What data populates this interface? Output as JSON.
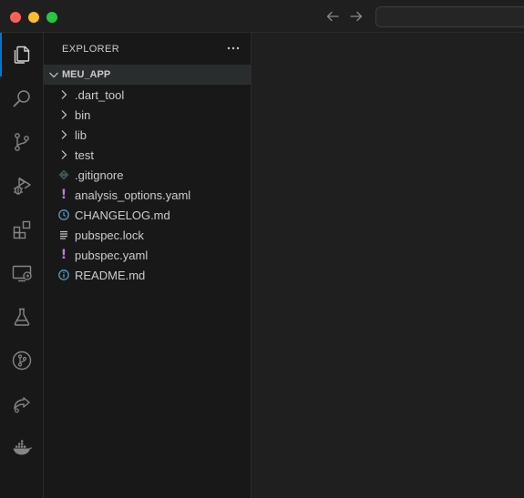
{
  "explorer": {
    "title": "EXPLORER",
    "folder": "MEU_APP",
    "items": [
      {
        "label": ".dart_tool",
        "type": "folder",
        "icon": "chevron-right-icon"
      },
      {
        "label": "bin",
        "type": "folder",
        "icon": "chevron-right-icon"
      },
      {
        "label": "lib",
        "type": "folder",
        "icon": "chevron-right-icon"
      },
      {
        "label": "test",
        "type": "folder",
        "icon": "chevron-right-icon"
      },
      {
        "label": ".gitignore",
        "type": "file",
        "icon": "git-file-icon"
      },
      {
        "label": "analysis_options.yaml",
        "type": "file",
        "icon": "yaml-file-icon"
      },
      {
        "label": "CHANGELOG.md",
        "type": "file",
        "icon": "changelog-file-icon"
      },
      {
        "label": "pubspec.lock",
        "type": "file",
        "icon": "lock-file-icon"
      },
      {
        "label": "pubspec.yaml",
        "type": "file",
        "icon": "yaml-file-icon"
      },
      {
        "label": "README.md",
        "type": "file",
        "icon": "info-file-icon"
      }
    ]
  },
  "activity_bar": {
    "items": [
      {
        "icon": "explorer-icon",
        "active": true
      },
      {
        "icon": "search-icon"
      },
      {
        "icon": "source-control-icon"
      },
      {
        "icon": "run-debug-icon"
      },
      {
        "icon": "extensions-icon"
      },
      {
        "icon": "remote-explorer-icon"
      },
      {
        "icon": "testing-icon"
      },
      {
        "icon": "git-graph-icon"
      },
      {
        "icon": "live-share-icon"
      },
      {
        "icon": "docker-icon"
      }
    ]
  },
  "colors": {
    "accent": "#0078d4",
    "yaml": "#c678dd",
    "changelog": "#519aba",
    "info": "#519aba"
  }
}
